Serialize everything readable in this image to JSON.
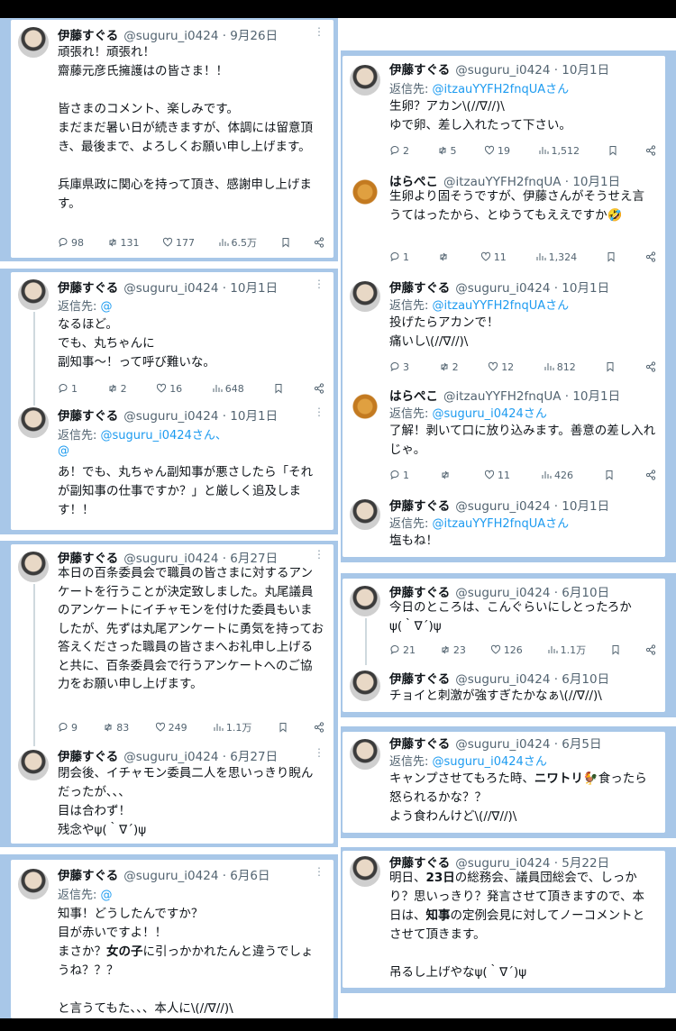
{
  "name": "伊藤すぐる",
  "handle": "@suguru_i0424",
  "name2": "はらぺこ",
  "handle2": "@itzauYYFH2fnqUA",
  "reply_prefix": "返信先:",
  "tweets": {
    "t1": {
      "date": "9月26日",
      "body": "頑張れ！頑張れ！\n齋藤元彦氏擁護はの皆さま！！\n\n皆さまのコメント、楽しみです。\nまだまだ暑い日が続きますが、体調には留意頂き、最後まで、よろしくお願い申し上げます。\n\n兵庫県政に関心を持って頂き、感謝申し上げます。",
      "reply": "98",
      "rt": "131",
      "like": "177",
      "views": "6.5万"
    },
    "t2": {
      "date": "10月1日",
      "reply_to": "@",
      "body": "なるほど。\nでも、丸ちゃんに\n副知事〜！って呼び難いな。",
      "reply": "1",
      "rt": "2",
      "like": "16",
      "views": "648"
    },
    "t3": {
      "date": "10月1日",
      "reply_to": "@suguru_i0424さん、",
      "reply_to2": "@",
      "body": "あ！でも、丸ちゃん副知事が悪さしたら「それが副知事の仕事ですか？」と厳しく追及します！！"
    },
    "t4": {
      "date": "6月27日",
      "body": "本日の百条委員会で職員の皆さまに対するアンケートを行うことが決定致しました。丸尾議員のアンケートにイチャモンを付けた委員もいましたが、先ずは丸尾アンケートに勇気を持ってお答えくださった職員の皆さまへお礼申し上げると共に、百条委員会で行うアンケートへのご協力をお願い申し上げます。",
      "reply": "9",
      "rt": "83",
      "like": "249",
      "views": "1.1万"
    },
    "t5": {
      "date": "6月27日",
      "body": "閉会後、イチャモン委員二人を思いっきり睨んだったが、、、\n目は合わず！\n残念やψ(｀∇´)ψ"
    },
    "t6": {
      "date": "6月6日",
      "reply_to": "@",
      "body_a": "知事！どうしたんですか？\n目が赤いですよ！！\nまさか？",
      "body_b": "女の子",
      "body_c": "に引っかかれたんと違うでしょうね？？？\n\nと言うてもた、、、本人に\\(//∇//)\\"
    },
    "t7": {
      "date": "10月1日",
      "reply_to": "@itzauYYFH2fnqUAさん",
      "body": "生卵？アカン\\(//∇//)\\\nゆで卵、差し入れたって下さい。",
      "reply": "2",
      "rt": "5",
      "like": "19",
      "views": "1,512"
    },
    "t8": {
      "date": "10月1日",
      "body": "生卵より固そうですが、伊藤さんがそうせえ言うてはったから、とゆうてもええですか🤣",
      "reply": "1",
      "rt": "",
      "like": "11",
      "views": "1,324"
    },
    "t9": {
      "date": "10月1日",
      "reply_to": "@itzauYYFH2fnqUAさん",
      "body": "投げたらアカンで！\n痛いし\\(//∇//)\\",
      "reply": "3",
      "rt": "2",
      "like": "12",
      "views": "812"
    },
    "t10": {
      "date": "10月1日",
      "reply_to": "@suguru_i0424さん",
      "body": "了解！剥いて口に放り込みます。善意の差し入れじゃ。",
      "reply": "1",
      "rt": "",
      "like": "11",
      "views": "426"
    },
    "t11": {
      "date": "10月1日",
      "reply_to": "@itzauYYFH2fnqUAさん",
      "body": "塩もね！"
    },
    "t12": {
      "date": "6月10日",
      "body": "今日のところは、こんぐらいにしとったろかψ(｀∇´)ψ",
      "reply": "21",
      "rt": "23",
      "like": "126",
      "views": "1.1万"
    },
    "t13": {
      "date": "6月10日",
      "body": "チョイと刺激が強すぎたかなぁ\\(//∇//)\\"
    },
    "t14": {
      "date": "6月5日",
      "reply_to": "@suguru_i0424さん",
      "body_a": "キャンプさせてもろた時、",
      "body_b": "ニワトリ",
      "body_c": "🐓食ったら怒られるかな？？\nよう食わんけど\\(//∇//)\\"
    },
    "t15": {
      "date": "5月22日",
      "body_a": "明日、",
      "body_b": "23日",
      "body_c": "の総務会、議員団総会で、しっかり？思いっきり？発言させて頂きますので、本日は、",
      "body_d": "知事",
      "body_e": "の定例会見に対してノーコメントとさせて頂きます。\n\n吊るし上げやなψ(｀∇´)ψ"
    }
  },
  "colors": {
    "panel": "#a8c7e8",
    "link": "#1d9bf0",
    "muted": "#536471"
  }
}
